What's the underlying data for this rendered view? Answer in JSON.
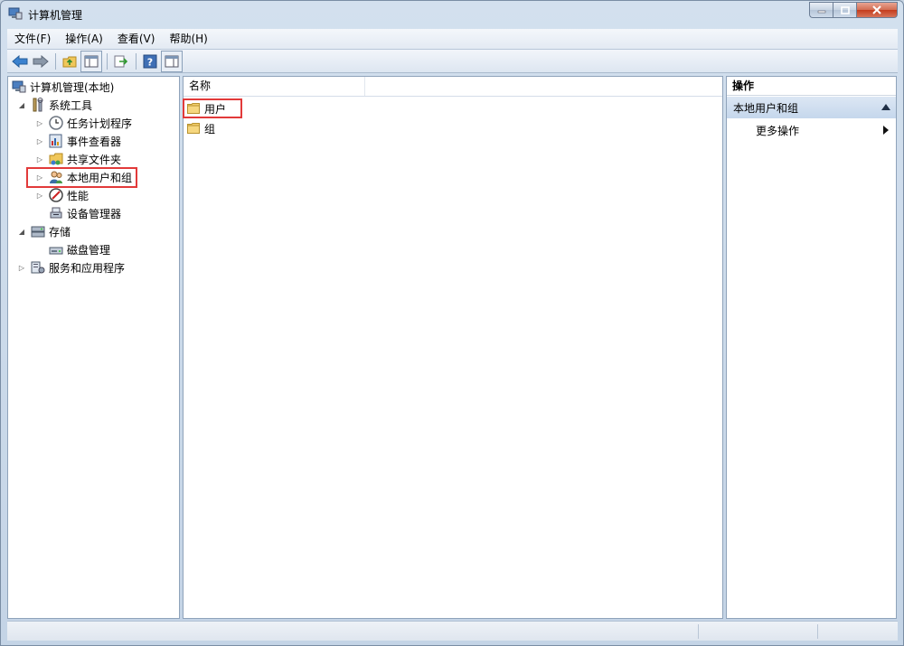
{
  "window": {
    "title": "计算机管理"
  },
  "menu": [
    "文件(F)",
    "操作(A)",
    "查看(V)",
    "帮助(H)"
  ],
  "toolbar": {
    "buttons": [
      "back-icon",
      "forward-icon",
      "up-folder-icon",
      "show-hide-tree-icon",
      "export-list-icon",
      "help-icon",
      "show-hide-action-pane-icon"
    ]
  },
  "tree": {
    "root": "计算机管理(本地)",
    "system_tools": "系统工具",
    "task_scheduler": "任务计划程序",
    "event_viewer": "事件查看器",
    "shared_folders": "共享文件夹",
    "local_users_groups": "本地用户和组",
    "performance": "性能",
    "device_manager": "设备管理器",
    "storage": "存储",
    "disk_management": "磁盘管理",
    "services_apps": "服务和应用程序"
  },
  "list": {
    "column_name": "名称",
    "items": [
      "用户",
      "组"
    ]
  },
  "actions": {
    "title": "操作",
    "group": "本地用户和组",
    "more": "更多操作"
  },
  "colors": {
    "highlight": "#e23a3a",
    "folder": "#f0c75a",
    "accent": "#3a6ea5"
  }
}
